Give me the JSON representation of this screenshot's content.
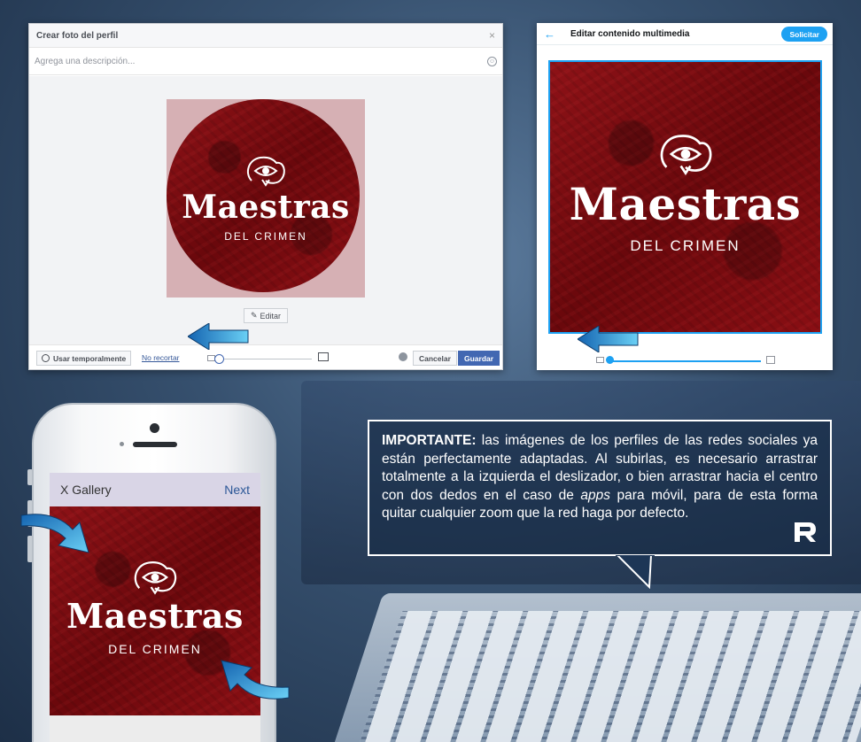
{
  "facebook": {
    "title": "Crear foto del perfil",
    "close": "×",
    "description_placeholder": "Agrega una descripción...",
    "edit_label": "Editar",
    "temp_label": "Usar temporalmente",
    "no_crop_label": "No recortar",
    "cancel_label": "Cancelar",
    "save_label": "Guardar",
    "zoom_level": 0.0
  },
  "twitter": {
    "back": "←",
    "title": "Editar contenido multimedia",
    "apply_label": "Solicitar",
    "zoom_level": 0.0
  },
  "logo": {
    "title": "Maestras",
    "subtitle": "DEL CRIMEN"
  },
  "phone": {
    "gallery_label": "X Gallery",
    "next_label": "Next"
  },
  "callout": {
    "bold": "IMPORTANTE:",
    "text_before_apps": " las imágenes de los perfiles de las redes sociales  ya están perfectamente adaptadas. Al subirlas, es necesario arrastrar totalmente a la izquierda el deslizador, o bien arrastrar hacia el centro con dos dedos en el caso de ",
    "apps": "apps",
    "text_after_apps": " para móvil, para de esta forma quitar cualquier zoom que la red haga por defecto."
  },
  "colors": {
    "facebook_blue": "#4267b2",
    "twitter_blue": "#1da1f2",
    "arrow_blue": "#1f8fd0",
    "logo_red": "#8e1217"
  },
  "icons": [
    "close-icon",
    "smile-icon",
    "magic-wand-icon",
    "clock-icon",
    "image-small-icon",
    "image-large-icon",
    "globe-icon",
    "back-arrow-icon",
    "eye-brain-icon",
    "brand-r-icon"
  ]
}
